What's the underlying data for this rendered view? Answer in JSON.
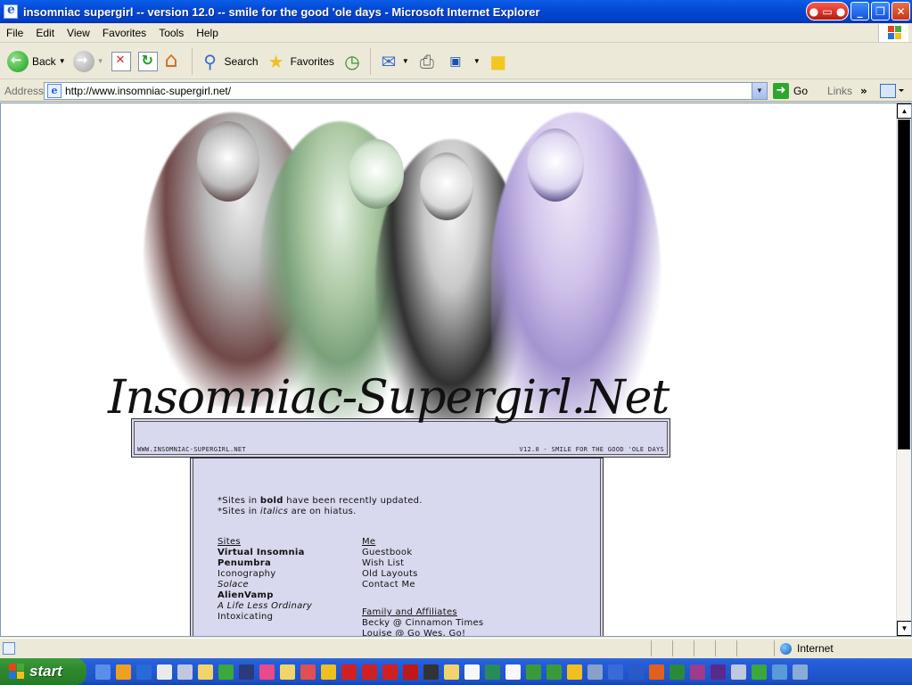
{
  "window": {
    "title": "insomniac supergirl -- version 12.0 -- smile for the good 'ole days - Microsoft Internet Explorer",
    "buttons": [
      "minimize",
      "maximize",
      "close"
    ]
  },
  "menu": [
    "File",
    "Edit",
    "View",
    "Favorites",
    "Tools",
    "Help"
  ],
  "toolbar": {
    "back_label": "Back",
    "search_label": "Search",
    "favorites_label": "Favorites"
  },
  "address_bar": {
    "label": "Address",
    "url": "http://www.insomniac-supergirl.net/",
    "go_label": "Go",
    "links_label": "Links"
  },
  "page": {
    "logo_text": "Insomniac-Supergirl.Net",
    "header_left": "WWW.INSOMNIAC-SUPERGIRL.NET",
    "header_right": "V12.0 - SMILE FOR THE GOOD 'OLE DAYS",
    "notes": {
      "bold_prefix": "*Sites in ",
      "bold_word": "bold",
      "bold_suffix": " have been recently updated.",
      "italic_prefix": "*Sites in ",
      "italic_word": "italics",
      "italic_suffix": " are on hiatus."
    },
    "sites": {
      "heading": "Sites",
      "items": [
        {
          "label": "Virtual Insomnia",
          "style": "bold"
        },
        {
          "label": "Penumbra",
          "style": "bold"
        },
        {
          "label": "Iconography",
          "style": "normal"
        },
        {
          "label": "Solace",
          "style": "italic"
        },
        {
          "label": "AlienVamp",
          "style": "bold"
        },
        {
          "label": "A Life Less Ordinary",
          "style": "italic"
        },
        {
          "label": "Intoxicating",
          "style": "normal"
        }
      ]
    },
    "me": {
      "heading": "Me",
      "items": [
        "Guestbook",
        "Wish List",
        "Old Layouts",
        "Contact Me"
      ]
    },
    "affiliates": {
      "heading": "Family and Affiliates",
      "items": [
        "Becky @ Cinnamon Times",
        "Louise @ Go Wes, Go!"
      ]
    }
  },
  "status": {
    "zone": "Internet"
  },
  "taskbar": {
    "start_label": "start"
  },
  "colors": {
    "titlebar": "#0449d4",
    "content_bg": "#d8d8ee",
    "start_green": "#2e8a2e"
  }
}
